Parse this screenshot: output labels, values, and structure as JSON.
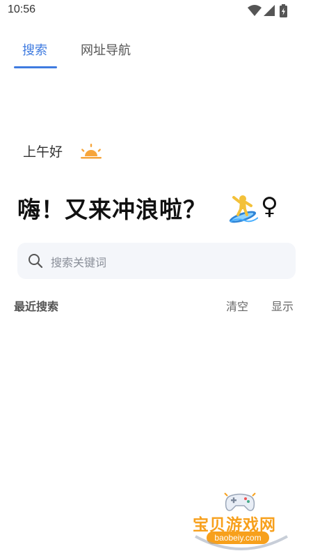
{
  "status_bar": {
    "time": "10:56",
    "icons": [
      "wifi-icon",
      "signal-icon",
      "battery-icon"
    ]
  },
  "tabs": [
    {
      "label": "搜索",
      "active": true
    },
    {
      "label": "网址导航",
      "active": false
    }
  ],
  "greeting": {
    "text": "上午好",
    "icon": "sunrise-icon"
  },
  "headline": {
    "text": "嗨！又来冲浪啦？",
    "emoji": [
      "surfer-icon",
      "female-sign-icon"
    ],
    "female_sign": "♀"
  },
  "search": {
    "placeholder": "搜索关键词",
    "icon": "search-icon"
  },
  "recent": {
    "title": "最近搜索",
    "clear_label": "清空",
    "show_label": "显示"
  },
  "watermark": {
    "text": "宝贝游戏网",
    "url": "baobeiy.com"
  },
  "colors": {
    "accent": "#3f7be0",
    "search_bg": "#f4f6fa",
    "sun": "#f6a53b",
    "watermark": "#f7a01c"
  }
}
